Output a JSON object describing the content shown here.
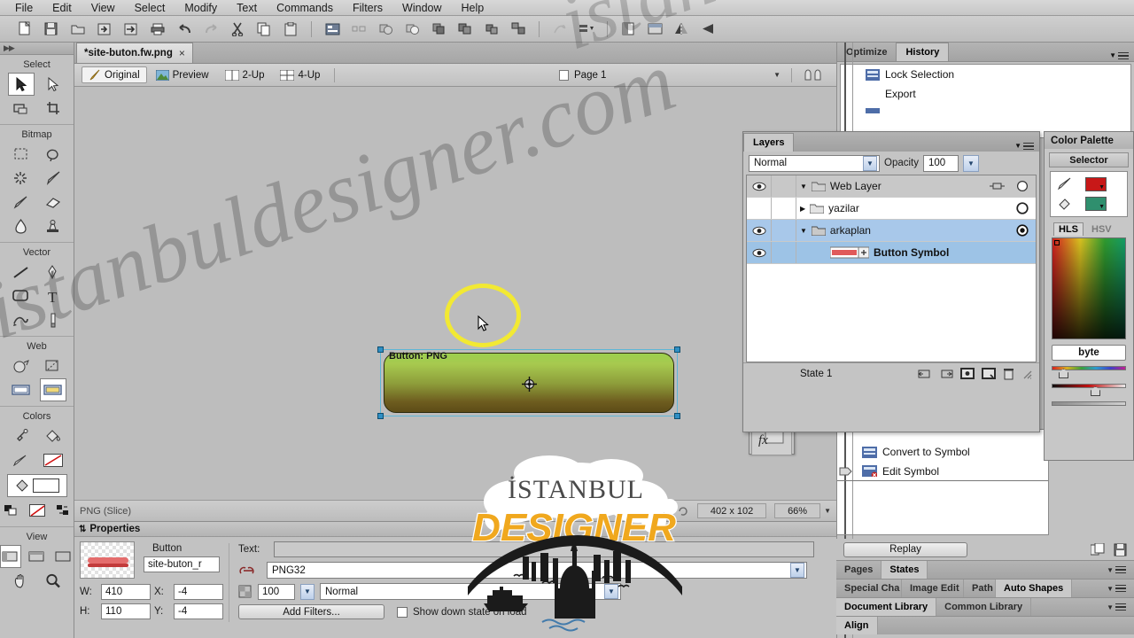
{
  "app": {
    "name": "Adobe Fireworks",
    "menu": [
      "File",
      "Edit",
      "View",
      "Select",
      "Modify",
      "Text",
      "Commands",
      "Filters",
      "Window",
      "Help"
    ]
  },
  "toolbar": {
    "buttons": [
      "new-document-icon",
      "save-icon",
      "open-folder-icon",
      "import-icon",
      "export-icon",
      "print-icon",
      "undo-icon",
      "redo-icon",
      "cut-icon",
      "copy-icon",
      "paste-icon",
      "align-left-icon",
      "align-distribute-icon",
      "union-icon",
      "subtract-icon",
      "intersect-icon",
      "punch-icon",
      "crop-icon",
      "group-icon",
      "edit-path-icon",
      "arrange-icon",
      "show-hide-icon",
      "fit-selection-icon",
      "flip-horizontal-icon",
      "flip-vertical-icon"
    ]
  },
  "tools": {
    "groups": [
      {
        "title": "Select",
        "rows": [
          [
            "pointer-tool",
            "subselect-tool"
          ],
          [
            "scale-tool",
            "crop-tool"
          ]
        ]
      },
      {
        "title": "Bitmap",
        "rows": [
          [
            "marquee-tool",
            "lasso-tool"
          ],
          [
            "magic-wand-tool",
            "brush-tool"
          ],
          [
            "pencil-tool",
            "eraser-tool"
          ],
          [
            "blur-tool",
            "rubber-stamp-tool"
          ]
        ]
      },
      {
        "title": "Vector",
        "rows": [
          [
            "line-tool",
            "pen-tool"
          ],
          [
            "rectangle-tool",
            "text-tool"
          ],
          [
            "freeform-tool",
            "knife-tool"
          ]
        ]
      },
      {
        "title": "Web",
        "rows": [
          [
            "hotspot-tool",
            "slice-tool"
          ],
          [
            "hide-slices-tool",
            "show-slices-tool"
          ]
        ]
      },
      {
        "title": "Colors",
        "rows": [
          [
            "eyedropper-tool",
            "paint-bucket-tool"
          ],
          [
            "stroke-color-tool",
            "fill-color-tool"
          ]
        ]
      },
      {
        "title": "View",
        "rows": [
          [
            "standard-screen-tool",
            "full-screen-menu-tool",
            "full-screen-tool"
          ],
          [
            "hand-tool",
            "zoom-tool"
          ]
        ]
      }
    ],
    "selected": "pointer-tool"
  },
  "document": {
    "tab_title": "*site-buton.fw.png",
    "close_glyph": "×",
    "view_modes": [
      {
        "id": "original",
        "label": "Original",
        "active": true
      },
      {
        "id": "preview",
        "label": "Preview",
        "active": false
      },
      {
        "id": "two-up",
        "label": "2-Up",
        "active": false
      },
      {
        "id": "four-up",
        "label": "4-Up",
        "active": false
      }
    ],
    "page_label": "Page 1",
    "canvas": {
      "object_label": "Button: PNG",
      "selection_handles": 4
    },
    "status": {
      "object_type": "PNG (Slice)",
      "dimensions": "402 x 102",
      "zoom": "66%"
    }
  },
  "floating_fx": {
    "title_icons": [
      "expand-icon",
      "close-icon"
    ],
    "body_icon": "fx-icon"
  },
  "history_panel": {
    "tabs": [
      {
        "label": "Optimize",
        "active": false
      },
      {
        "label": "History",
        "active": true
      }
    ],
    "items": [
      {
        "label": "Lock Selection",
        "icon": "history-step-icon"
      },
      {
        "label": "Export",
        "icon": ""
      }
    ]
  },
  "history_lower": {
    "items": [
      {
        "label": "Convert to Symbol",
        "icon": "history-step-icon"
      },
      {
        "label": "Edit Symbol",
        "icon": "history-step-error-icon"
      }
    ],
    "replay_label": "Replay",
    "footer_icons": [
      "copy-steps-icon",
      "save-steps-icon"
    ]
  },
  "layers_panel": {
    "tab_label": "Layers",
    "blend_mode": "Normal",
    "opacity_label": "Opacity",
    "opacity_value": "100",
    "rows": [
      {
        "name": "Web Layer",
        "visible": true,
        "expanded": true,
        "type": "web",
        "selected": false,
        "radio": "empty"
      },
      {
        "name": "yazilar",
        "visible": false,
        "expanded": false,
        "type": "folder",
        "selected": false,
        "radio": "empty"
      },
      {
        "name": "arkaplan",
        "visible": true,
        "expanded": true,
        "type": "folder",
        "selected": true,
        "radio": "filled"
      },
      {
        "name": "Button Symbol",
        "visible": true,
        "expanded": false,
        "type": "symbol",
        "selected": true,
        "radio": "none"
      }
    ],
    "state_label": "State 1",
    "footer_icons": [
      "new-state-icon",
      "duplicate-state-icon",
      "new-bitmap-icon",
      "new-layer-icon",
      "delete-icon"
    ]
  },
  "color_palette": {
    "title": "Color Palette",
    "sub_tab": "Selector",
    "stroke_color": "#c81818",
    "fill_color": "#2f8f6e",
    "modes": [
      {
        "label": "HLS",
        "active": true
      },
      {
        "label": "HSV",
        "active": false
      }
    ],
    "byte_label": "byte",
    "stroke_icon": "pencil-icon",
    "fill_icon": "bucket-icon"
  },
  "dock_tabs": {
    "row1": [
      {
        "label": "Pages",
        "active": false
      },
      {
        "label": "States",
        "active": true
      }
    ],
    "row2": [
      {
        "label": "Special Cha",
        "active": false
      },
      {
        "label": "Image Edit",
        "active": false
      },
      {
        "label": "Path",
        "active": false
      },
      {
        "label": "Auto Shapes",
        "active": true
      }
    ],
    "row3": [
      {
        "label": "Document Library",
        "active": true
      },
      {
        "label": "Common Library",
        "active": false
      }
    ],
    "row4": [
      {
        "label": "Align",
        "active": true
      }
    ]
  },
  "properties": {
    "title": "Properties",
    "object_kind": "Button",
    "object_name": "site-buton_r",
    "width_label": "W:",
    "width_value": "410",
    "height_label": "H:",
    "height_value": "110",
    "x_label": "X:",
    "x_value": "-4",
    "y_label": "Y:",
    "y_value": "-4",
    "text_label": "Text:",
    "text_value": "",
    "format_value": "PNG32",
    "opacity_value": "100",
    "blend_value": "Normal",
    "add_filters_label": "Add Filters...",
    "show_down_label": "Show down state on load",
    "show_down_checked": false,
    "link_label": "",
    "link_value": ""
  },
  "watermark": {
    "text": "istanbuldesigner.com",
    "logo_top": "ISTANBUL",
    "logo_bottom": "DESIGNER"
  }
}
